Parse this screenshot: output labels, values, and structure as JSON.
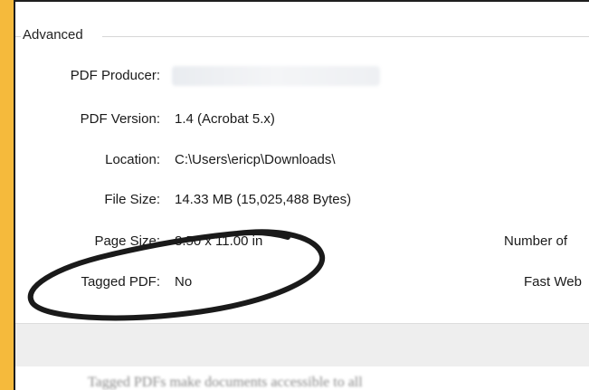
{
  "section": {
    "title": "Advanced"
  },
  "fields": [
    {
      "label": "PDF Producer:",
      "value": ""
    },
    {
      "label": "PDF Version:",
      "value": "1.4 (Acrobat 5.x)"
    },
    {
      "label": "Location:",
      "value": "C:\\Users\\ericp\\Downloads\\"
    },
    {
      "label": "File Size:",
      "value": "14.33 MB (15,025,488 Bytes)"
    },
    {
      "label": "Page Size:",
      "value": "8.50 x 11.00 in"
    },
    {
      "label": "Tagged PDF:",
      "value": "No"
    }
  ],
  "right_fields": {
    "pages_label": "Number of",
    "fast_web_label": "Fast Web"
  },
  "footer": {
    "obscured_text": "Tagged PDFs make documents accessible to all"
  },
  "colors": {
    "frame": "#f5ba3c",
    "annotation_stroke": "#1a1a1a"
  },
  "annotation": {
    "shape": "hand-drawn-ellipse",
    "target": "Tagged PDF: No"
  }
}
